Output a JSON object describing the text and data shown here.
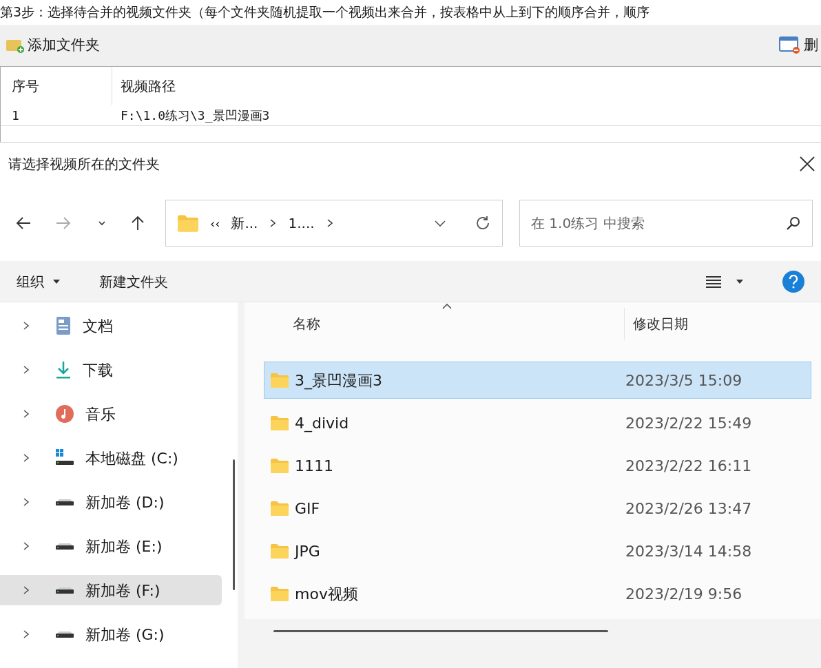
{
  "instruction": "第3步：选择待合并的视频文件夹（每个文件夹随机提取一个视频出来合并，按表格中从上到下的顺序合并，顺序",
  "toolbar": {
    "add_button": "添加文件夹",
    "delete_button": "删"
  },
  "table": {
    "columns": [
      "序号",
      "视频路径"
    ],
    "rows": [
      {
        "index": "1",
        "path": "F:\\1.0练习\\3_景凹漫画3"
      }
    ]
  },
  "dialog": {
    "title": "请选择视频所在的文件夹",
    "breadcrumb_overflow": "‹‹",
    "breadcrumb": [
      "新...",
      "1...."
    ],
    "search": {
      "placeholder": "在 1.0练习 中搜索"
    },
    "commands": {
      "organize": "组织",
      "new_folder": "新建文件夹"
    },
    "nav_items": [
      {
        "label": "文档",
        "kind": "documents",
        "selected": false
      },
      {
        "label": "下载",
        "kind": "downloads",
        "selected": false
      },
      {
        "label": "音乐",
        "kind": "music",
        "selected": false
      },
      {
        "label": "本地磁盘 (C:)",
        "kind": "system-drive",
        "selected": false
      },
      {
        "label": "新加卷 (D:)",
        "kind": "drive",
        "selected": false
      },
      {
        "label": "新加卷 (E:)",
        "kind": "drive",
        "selected": false
      },
      {
        "label": "新加卷 (F:)",
        "kind": "drive",
        "selected": true
      },
      {
        "label": "新加卷 (G:)",
        "kind": "drive",
        "selected": false
      }
    ],
    "columns": [
      "名称",
      "修改日期"
    ],
    "files": [
      {
        "name": "3_景凹漫画3",
        "date": "2023/3/5 15:09",
        "selected": true
      },
      {
        "name": "4_divid",
        "date": "2023/2/22 15:49",
        "selected": false
      },
      {
        "name": "1111",
        "date": "2023/2/22 16:11",
        "selected": false
      },
      {
        "name": "GIF",
        "date": "2023/2/26 13:47",
        "selected": false
      },
      {
        "name": "JPG",
        "date": "2023/3/14 14:58",
        "selected": false
      },
      {
        "name": "mov视频",
        "date": "2023/2/19 9:56",
        "selected": false
      }
    ]
  }
}
